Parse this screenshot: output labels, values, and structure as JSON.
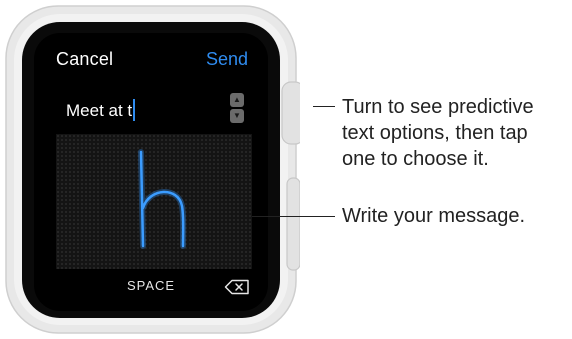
{
  "watch": {
    "cancel_label": "Cancel",
    "send_label": "Send",
    "message_text": "Meet at t",
    "space_label": "SPACE",
    "handwriting_glyph": "h"
  },
  "callouts": {
    "crown": [
      "Turn to see predictive",
      "text options, then tap",
      "one to choose it."
    ],
    "write": "Write your message."
  },
  "colors": {
    "accent": "#2f8cf0",
    "screen": "#000000",
    "case": "#e6e6e6"
  },
  "icons": [
    "digital-crown",
    "side-button",
    "stepper-arrows",
    "delete-backspace-icon"
  ]
}
